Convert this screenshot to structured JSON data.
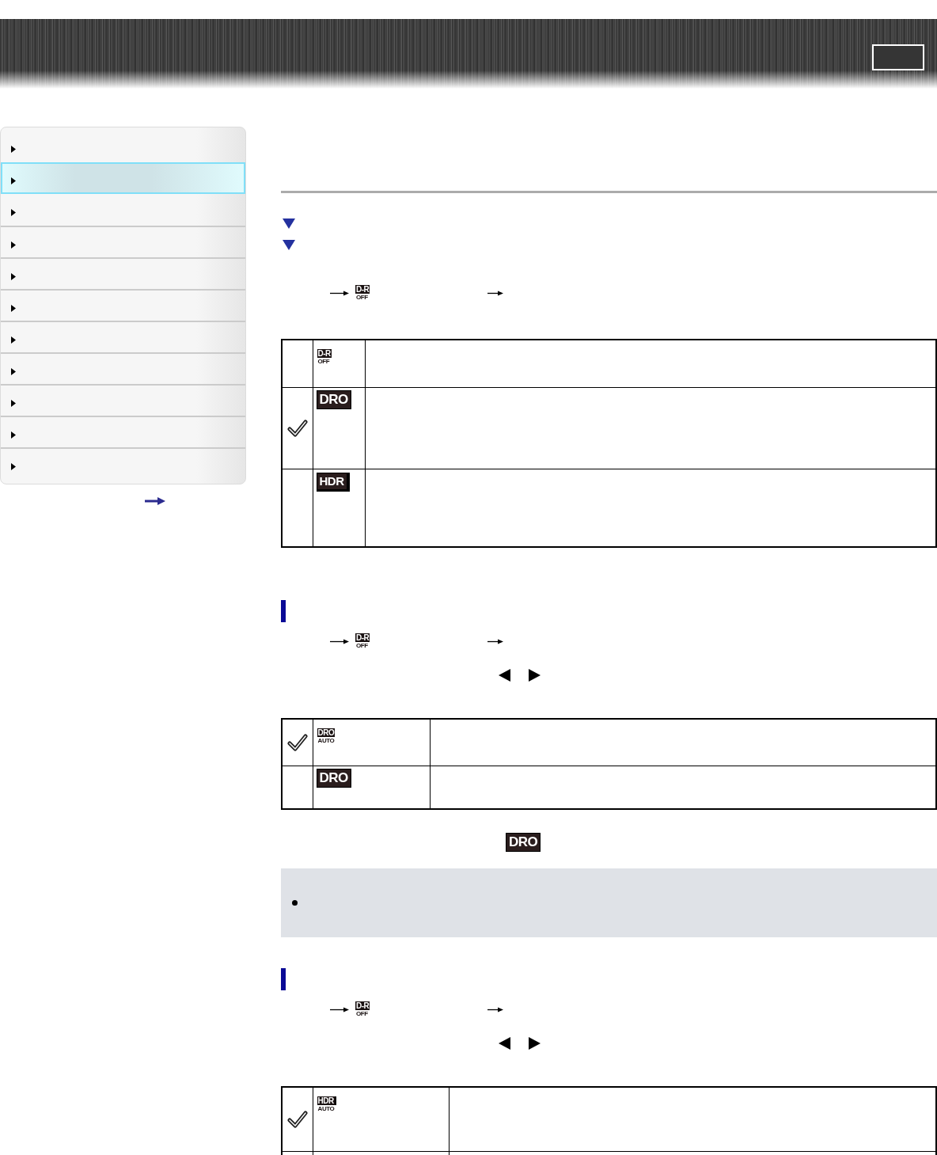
{
  "sidebar": {
    "items": [
      {
        "selected": false
      },
      {
        "selected": true
      },
      {
        "selected": false
      },
      {
        "selected": false
      },
      {
        "selected": false
      },
      {
        "selected": false
      },
      {
        "selected": false
      },
      {
        "selected": false
      },
      {
        "selected": false
      },
      {
        "selected": false
      },
      {
        "selected": false
      }
    ]
  },
  "content": [
    {
      "kind": "rule"
    },
    {
      "kind": "jump_link"
    },
    {
      "kind": "jump_link"
    },
    {
      "kind": "menu_path",
      "icon": {
        "kind": "stacked",
        "top": "D-R",
        "bottom": "OFF"
      }
    },
    {
      "kind": "table",
      "rows": [
        {
          "checked": false,
          "icon": {
            "kind": "stacked",
            "top": "D-R",
            "bottom": "OFF"
          }
        },
        {
          "checked": true,
          "icon": {
            "kind": "plate",
            "text": "DRO"
          }
        },
        {
          "checked": false,
          "icon": {
            "kind": "tab_plate",
            "text": "HDR"
          }
        }
      ]
    },
    {
      "kind": "heading"
    },
    {
      "kind": "menu_path",
      "icon": {
        "kind": "stacked",
        "top": "D-R",
        "bottom": "OFF"
      }
    },
    {
      "kind": "arrow_keys"
    },
    {
      "kind": "table",
      "rows": [
        {
          "checked": true,
          "icon": {
            "kind": "stacked",
            "top": "DRO",
            "bottom": "AUTO"
          }
        },
        {
          "checked": false,
          "icon": {
            "kind": "plate",
            "text": "DRO"
          }
        }
      ]
    },
    {
      "kind": "icon_line",
      "icon": {
        "kind": "plate",
        "text": "DRO"
      }
    },
    {
      "kind": "note"
    },
    {
      "kind": "heading"
    },
    {
      "kind": "menu_path",
      "icon": {
        "kind": "stacked",
        "top": "D-R",
        "bottom": "OFF"
      }
    },
    {
      "kind": "arrow_keys"
    },
    {
      "kind": "table",
      "rows": [
        {
          "checked": true,
          "icon": {
            "kind": "stacked_tab",
            "top": "HDR",
            "bottom": "AUTO"
          }
        },
        {
          "checked": false
        }
      ]
    }
  ]
}
